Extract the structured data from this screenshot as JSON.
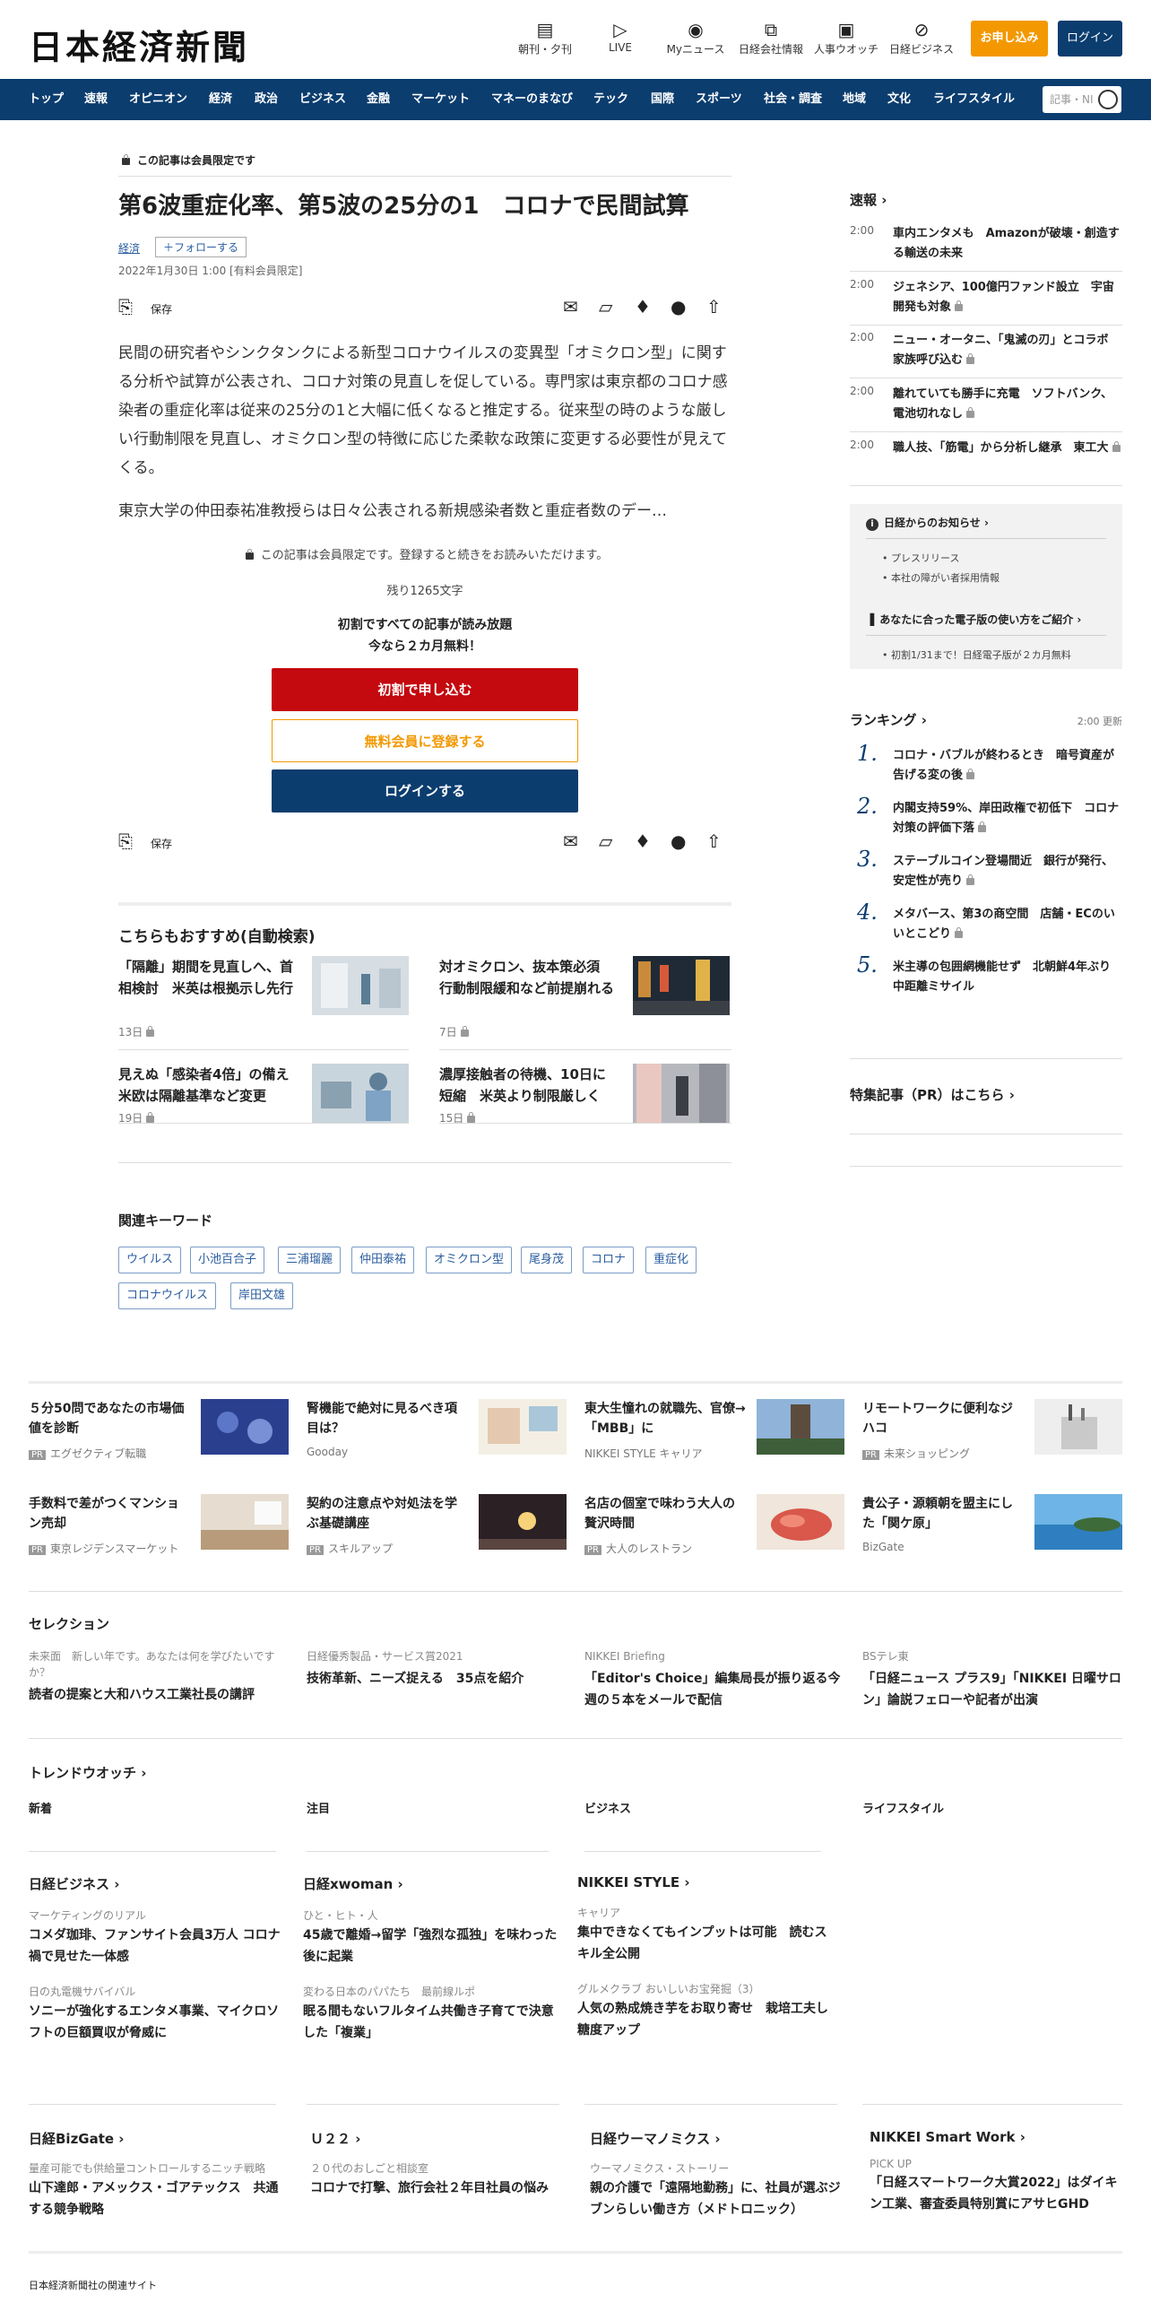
{
  "header": {
    "logo": "日本経済新聞",
    "icons": [
      {
        "label": "朝刊・夕刊",
        "icon": "newspaper-icon",
        "glyph": "▤"
      },
      {
        "label": "LIVE",
        "icon": "video-icon",
        "glyph": "▷"
      },
      {
        "label": "Myニュース",
        "icon": "user-icon",
        "glyph": "◉"
      },
      {
        "label": "日経会社情報",
        "icon": "chart-icon",
        "glyph": "⧉"
      },
      {
        "label": "人事ウオッチ",
        "icon": "search-person-icon",
        "glyph": "▣"
      },
      {
        "label": "日経ビジネス",
        "icon": "compass-icon",
        "glyph": "⊘"
      }
    ],
    "apply_label": "お申し込み",
    "login_label": "ログイン"
  },
  "nav": {
    "items": [
      "トップ",
      "速報",
      "オピニオン",
      "経済",
      "政治",
      "ビジネス",
      "金融",
      "マーケット",
      "マネーのまなび",
      "テック",
      "国際",
      "スポーツ",
      "社会・調査",
      "地域",
      "文化",
      "ライフスタイル"
    ],
    "search_placeholder": "記事・NI"
  },
  "article": {
    "members_only": "この記事は会員限定です",
    "title": "第6波重症化率、第5波の25分の1　コロナで民間試算",
    "category": "経済",
    "follow": "＋フォローする",
    "date": "2022年1月30日 1:00 [有料会員限定]",
    "save": "保存",
    "body1": "民間の研究者やシンクタンクによる新型コロナウイルスの変異型「オミクロン型」に関する分析や試算が公表され、コロナ対策の見直しを促している。専門家は東京都のコロナ感染者の重症化率は従来の25分の1と大幅に低くなると推定する。従来型の時のような厳しい行動制限を見直し、オミクロン型の特徴に応じた柔軟な政策に変更する必要性が見えてくる。",
    "body2": "東京大学の仲田泰祐准教授らは日々公表される新規感染者数と重症者数のデー…",
    "paywall_note": "この記事は会員限定です。登録すると続きをお読みいただけます。",
    "remaining": "残り1265文字",
    "promo1": "初割ですべての記事が読み放題",
    "promo2": "今なら２カ月無料！",
    "btn_trial": "初割で申し込む",
    "btn_free": "無料会員に登録する",
    "btn_login": "ログインする"
  },
  "recommend": {
    "heading": "こちらもおすすめ(自動検索)",
    "items": [
      {
        "title": "「隔離」期間を見直しへ、首相検討　米英は根拠示し先行",
        "date": "13日"
      },
      {
        "title": "対オミクロン、抜本策必須　行動制限緩和など前提崩れる",
        "date": "7日"
      },
      {
        "title": "見えぬ「感染者4倍」の備え　米欧は隔離基準など変更",
        "date": "19日"
      },
      {
        "title": "濃厚接触者の待機、10日に短縮　米英より制限厳しく",
        "date": "15日"
      }
    ]
  },
  "keywords": {
    "heading": "関連キーワード",
    "items": [
      "ウイルス",
      "小池百合子",
      "三浦瑠麗",
      "仲田泰祐",
      "オミクロン型",
      "尾身茂",
      "コロナ",
      "重症化",
      "コロナウイルス",
      "岸田文雄"
    ]
  },
  "sidebar": {
    "sokuho_heading": "速報 ›",
    "sokuho": [
      {
        "time": "2:00",
        "text": "車内エンタメも　Amazonが破壊・創造する輸送の未来"
      },
      {
        "time": "2:00",
        "text": "ジェネシア、100億円ファンド設立　宇宙開発も対象"
      },
      {
        "time": "2:00",
        "text": "ニュー・オータニ、「鬼滅の刃」とコラボ　家族呼び込む"
      },
      {
        "time": "2:00",
        "text": "離れていても勝手に充電　ソフトバンク、電池切れなし"
      },
      {
        "time": "2:00",
        "text": "職人技、「筋電」から分析し継承　東工大"
      }
    ],
    "notice_heading": "日経からのお知らせ ›",
    "notice_items": [
      "プレスリリース",
      "本社の障がい者採用情報"
    ],
    "ebook_heading": "あなたに合った電子版の使い方をご紹介 ›",
    "ebook_item": "初割1/31まで！日経電子版が２カ月無料",
    "ranking_heading": "ランキング ›",
    "ranking_update": "2:00 更新",
    "ranking": [
      "コロナ・バブルが終わるとき　暗号資産が告げる変の後",
      "内閣支持59%、岸田政権で初低下　コロナ対策の評価下落",
      "ステーブルコイン登場間近　銀行が発行、安定性が売り",
      "メタバース、第3の商空間　店舗・ECのいいとこどり",
      "米主導の包囲網機能せず　北朝鮮4年ぶり中距離ミサイル"
    ],
    "pr_heading": "特集記事（PR）はこちら ›"
  },
  "ads": [
    {
      "title": "５分50問であなたの市場価値を診断",
      "source": "エグゼクティブ転職",
      "pr": true
    },
    {
      "title": "腎機能で絶対に見るべき項目は？",
      "source": "Gooday",
      "pr": false
    },
    {
      "title": "東大生憧れの就職先、官僚→「MBB」に",
      "source": "NIKKEI STYLE キャリア",
      "pr": false
    },
    {
      "title": "リモートワークに便利なジハコ",
      "source": "未来ショッピング",
      "pr": true
    },
    {
      "title": "手数料で差がつくマンション売却",
      "source": "東京レジデンスマーケット",
      "pr": true
    },
    {
      "title": "契約の注意点や対処法を学ぶ基礎講座",
      "source": "スキルアップ",
      "pr": true
    },
    {
      "title": "名店の個室で味わう大人の贅沢時間",
      "source": "大人のレストラン",
      "pr": true
    },
    {
      "title": "貴公子・源頼朝を盟主にした「関ケ原」",
      "source": "BizGate",
      "pr": false
    }
  ],
  "pr_label": "PR",
  "selection": {
    "heading": "セレクション",
    "items": [
      {
        "label": "未来面　新しい年です。あなたは何を学びたいですか？",
        "title": "読者の提案と大和ハウス工業社長の講評"
      },
      {
        "label": "日経優秀製品・サービス賞2021",
        "title": "技術革新、ニーズ捉える　35点を紹介"
      },
      {
        "label": "NIKKEI Briefing",
        "title": "「Editor's Choice」編集局長が振り返る今週の５本をメールで配信"
      },
      {
        "label": "BSテレ東",
        "title": "「日経ニュース プラス9」「NIKKEI 日曜サロン」論説フェローや記者が出演"
      }
    ]
  },
  "trend": {
    "heading": "トレンドウオッチ ›",
    "tabs": [
      "新着",
      "注目",
      "ビジネス",
      "ライフスタイル"
    ]
  },
  "media1": [
    {
      "head": "日経ビジネス ›",
      "items": [
        {
          "label": "マーケティングのリアル",
          "title": "コメダ珈琲、ファンサイト会員3万人 コロナ禍で見せた一体感"
        },
        {
          "label": "日の丸電機サバイバル",
          "title": "ソニーが強化するエンタメ事業、マイクロソフトの巨額買収が脅威に"
        }
      ]
    },
    {
      "head": "日経xwoman ›",
      "items": [
        {
          "label": "ひと・ヒト・人",
          "title": "45歳で離婚→留学「強烈な孤独」を味わった後に起業"
        },
        {
          "label": "変わる日本のパパたち　最前線ルポ",
          "title": "眠る間もないフルタイム共働き子育てで決意した「複業」"
        }
      ]
    },
    {
      "head": "NIKKEI STYLE ›",
      "items": [
        {
          "label": "キャリア",
          "title": "集中できなくてもインプットは可能　読むスキル全公開"
        },
        {
          "label": "グルメクラブ おいしいお宝発掘（3）",
          "title": "人気の熟成焼き芋をお取り寄せ　栽培工夫し糖度アップ"
        }
      ]
    }
  ],
  "media2": [
    {
      "head": "日経BizGate ›",
      "label": "量産可能でも供給量コントロールするニッチ戦略",
      "title": "山下達郎・アメックス・ゴアテックス　共通する競争戦略"
    },
    {
      "head": "Ｕ２２ ›",
      "label": "２０代のおしごと相談室",
      "title": "コロナで打撃、旅行会社２年目社員の悩み"
    },
    {
      "head": "日経ウーマノミクス ›",
      "label": "ウーマノミクス・ストーリー",
      "title": "親の介護で「遠隔地勤務」に、社員が選ぶジブンらしい働き方（メドトロニック）"
    },
    {
      "head": "NIKKEI Smart Work ›",
      "label": "PICK UP",
      "title": "「日経スマートワーク大賞2022」はダイキン工業、審査委員特別賞にアサヒGHD"
    }
  ],
  "footer_label": "日本経済新聞社の関連サイト",
  "colors": {
    "navy": "#0b3d6f",
    "orange": "#f39800",
    "red": "#c4090f"
  }
}
